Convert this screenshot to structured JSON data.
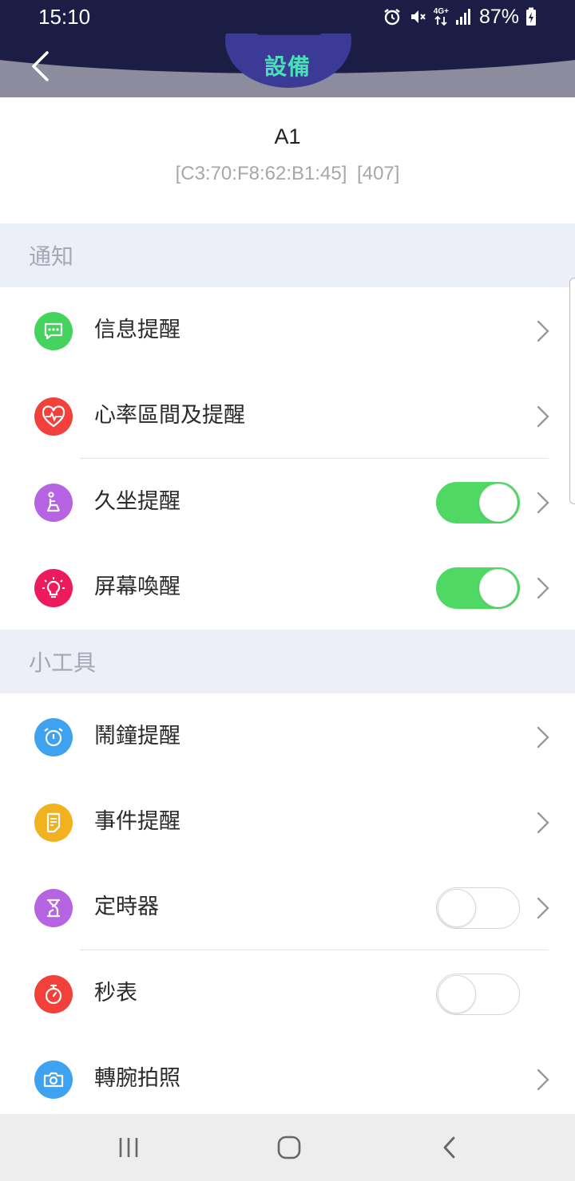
{
  "status_bar": {
    "time": "15:10",
    "network": "4G+",
    "battery": "87%",
    "icons": [
      "alarm-icon",
      "mute-icon",
      "network-4g-icon",
      "signal-icon",
      "battery-charging-icon"
    ]
  },
  "header": {
    "title": "設備",
    "back_icon": "chevron-left-icon"
  },
  "device": {
    "name": "A1",
    "mac": "[C3:70:F8:62:B1:45]",
    "id": "[407]"
  },
  "sections": {
    "notify": {
      "title": "通知",
      "items": [
        {
          "label": "信息提醒",
          "icon": "message-icon",
          "color": "#44d35c",
          "toggle": null,
          "chevron": true
        },
        {
          "label": "心率區間及提醒",
          "icon": "heart-rate-icon",
          "color": "#f2403a",
          "toggle": null,
          "chevron": true
        },
        {
          "label": "久坐提醒",
          "icon": "sedentary-icon",
          "color": "#b664e2",
          "toggle": "on",
          "chevron": true
        },
        {
          "label": "屏幕喚醒",
          "icon": "lightbulb-icon",
          "color": "#ed1a5e",
          "toggle": "on",
          "chevron": true
        }
      ]
    },
    "tools": {
      "title": "小工具",
      "items": [
        {
          "label": "鬧鐘提醒",
          "icon": "alarm-clock-icon",
          "color": "#3ea2f0",
          "toggle": null,
          "chevron": true
        },
        {
          "label": "事件提醒",
          "icon": "event-note-icon",
          "color": "#f2b220",
          "toggle": null,
          "chevron": true
        },
        {
          "label": "定時器",
          "icon": "timer-icon",
          "color": "#b664e2",
          "toggle": "off",
          "chevron": true
        },
        {
          "label": "秒表",
          "icon": "stopwatch-icon",
          "color": "#f2403a",
          "toggle": "off",
          "chevron": false
        },
        {
          "label": "轉腕拍照",
          "icon": "camera-icon",
          "color": "#3ea2f0",
          "toggle": null,
          "chevron": true
        }
      ]
    }
  },
  "nav": {
    "recent_icon": "recent-apps-icon",
    "home_icon": "home-icon",
    "back_icon": "back-icon"
  },
  "colors": {
    "status_bg": "#1c1d44",
    "header_bg": "#8c8c9e",
    "accent_title": "#48e0b6",
    "section_bg": "#eceef8",
    "toggle_on": "#4fd864"
  }
}
